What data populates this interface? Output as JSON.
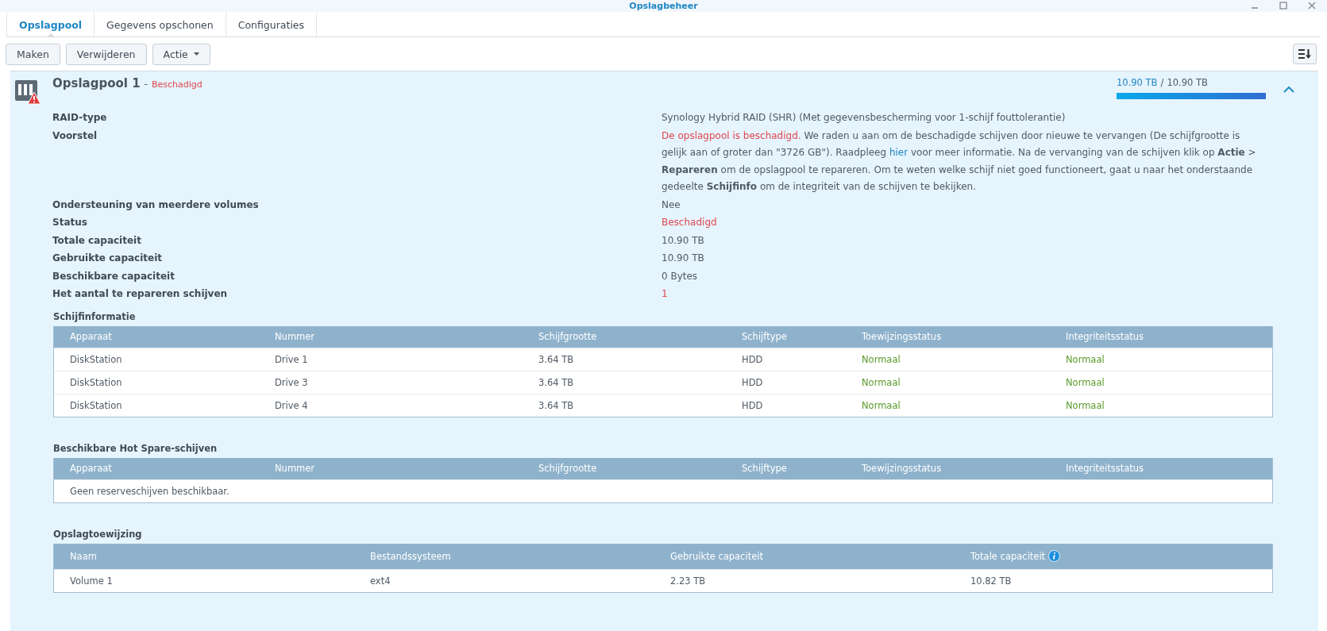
{
  "window": {
    "title": "Opslagbeheer"
  },
  "tabs": [
    {
      "label": "Opslagpool",
      "selected": true
    },
    {
      "label": "Gegevens opschonen",
      "selected": false
    },
    {
      "label": "Configuraties",
      "selected": false
    }
  ],
  "toolbar": {
    "buttons": [
      {
        "label": "Maken",
        "dropdown": false
      },
      {
        "label": "Verwijderen",
        "dropdown": false
      },
      {
        "label": "Actie",
        "dropdown": true
      }
    ]
  },
  "pool": {
    "name": "Opslagpool 1",
    "separator": "-",
    "status": "Beschadigd",
    "damaged": true,
    "expanded": true,
    "usage": {
      "used": "10.90 TB",
      "separator": "/",
      "total": "10.90 TB",
      "level": 1.0
    },
    "details": [
      {
        "label": "RAID-type",
        "kind": "text",
        "value": [
          {
            "kind": "text",
            "text": "Synology Hybrid RAID (SHR) (Met gegevensbescherming voor 1-schijf fouttolerantie)"
          }
        ]
      },
      {
        "label": "Voorstel",
        "kind": "text",
        "value": [
          {
            "kind": "alert",
            "text": "De opslagpool is beschadigd."
          },
          {
            "kind": "text",
            "text": " We raden u aan om de beschadigde schijven door nieuwe te vervangen (De schijfgrootte is gelijk aan of groter dan \"3726 GB\"). Raadpleeg "
          },
          {
            "kind": "link",
            "text": "hier"
          },
          {
            "kind": "text",
            "text": " voor meer informatie. Na de vervanging van de schijven klik op **Actie** > **Repareren** om de opslagpool te repareren. Om te weten welke schijf niet goed functioneert, gaat u naar het onderstaande gedeelte **Schijfinfo** om de integriteit van de schijven te bekijken."
          }
        ]
      },
      {
        "label": "Ondersteuning van meerdere volumes",
        "kind": "text",
        "value": [
          {
            "kind": "text",
            "text": "Nee"
          }
        ]
      },
      {
        "label": "Status",
        "kind": "alert",
        "value": [
          {
            "kind": "alert",
            "text": "Beschadigd"
          }
        ]
      },
      {
        "label": "Totale capaciteit",
        "kind": "text",
        "value": [
          {
            "kind": "text",
            "text": "10.90 TB"
          }
        ]
      },
      {
        "label": "Gebruikte capaciteit",
        "kind": "text",
        "value": [
          {
            "kind": "text",
            "text": "10.90 TB"
          }
        ]
      },
      {
        "label": "Beschikbare capaciteit",
        "kind": "text",
        "value": [
          {
            "kind": "text",
            "text": "0 Bytes"
          }
        ]
      },
      {
        "label": "Het aantal te repareren schijven",
        "kind": "alert",
        "value": [
          {
            "kind": "alert",
            "text": "1"
          }
        ]
      }
    ]
  },
  "disk_info": {
    "title": "Schijfinformatie",
    "columns": [
      {
        "label": "Apparaat",
        "kind": "text"
      },
      {
        "label": "Nummer",
        "kind": "text"
      },
      {
        "label": "Schijfgrootte",
        "kind": "text"
      },
      {
        "label": "Schijftype",
        "kind": "text"
      },
      {
        "label": "Toewijzingsstatus",
        "kind": "status"
      },
      {
        "label": "Integriteitsstatus",
        "kind": "status"
      }
    ],
    "rows": [
      [
        "DiskStation",
        "Drive 1",
        "3.64 TB",
        "HDD",
        "Normaal",
        "Normaal"
      ],
      [
        "DiskStation",
        "Drive 3",
        "3.64 TB",
        "HDD",
        "Normaal",
        "Normaal"
      ],
      [
        "DiskStation",
        "Drive 4",
        "3.64 TB",
        "HDD",
        "Normaal",
        "Normaal"
      ]
    ]
  },
  "hot_spare": {
    "title": "Beschikbare Hot Spare-schijven",
    "columns": [
      "Apparaat",
      "Nummer",
      "Schijfgrootte",
      "Schijftype",
      "Toewijzingsstatus",
      "Integriteitsstatus"
    ],
    "empty_message": "Geen reserveschijven beschikbaar."
  },
  "allocation": {
    "title": "Opslagtoewijzing",
    "columns": [
      {
        "label": "Naam",
        "info": false
      },
      {
        "label": "Bestandssysteem",
        "info": false
      },
      {
        "label": "Gebruikte capaciteit",
        "info": false
      },
      {
        "label": "Totale capaciteit",
        "info": true
      }
    ],
    "rows": [
      [
        "Volume 1",
        "ext4",
        "2.23 TB",
        "10.82 TB"
      ]
    ]
  }
}
